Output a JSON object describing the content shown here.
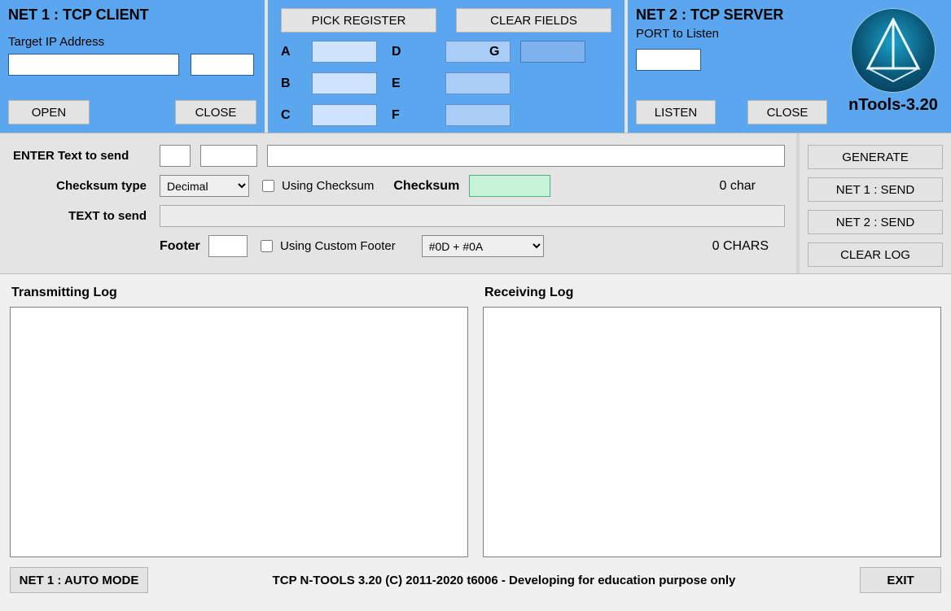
{
  "net1": {
    "title": "NET 1 : TCP CLIENT",
    "ip_label": "Target IP Address",
    "ip_value": "",
    "port_value": "",
    "open": "OPEN",
    "close": "CLOSE"
  },
  "regs": {
    "pick": "PICK REGISTER",
    "clear": "CLEAR FIELDS",
    "labels": {
      "A": "A",
      "B": "B",
      "C": "C",
      "D": "D",
      "E": "E",
      "F": "F",
      "G": "G"
    },
    "values": {
      "A": "",
      "B": "",
      "C": "",
      "D": "",
      "E": "",
      "F": "",
      "G": ""
    }
  },
  "net2": {
    "title": "NET 2 : TCP SERVER",
    "port_label": "PORT to Listen",
    "port_value": "",
    "listen": "LISTEN",
    "close": "CLOSE"
  },
  "branding": {
    "name": "nTools-3.20"
  },
  "form": {
    "enter_label": "ENTER Text to send",
    "small1": "",
    "small2": "",
    "long": "",
    "checksum_type_label": "Checksum type",
    "checksum_type_value": "Decimal",
    "using_checksum_label": "Using Checksum",
    "using_checksum_checked": false,
    "checksum_label": "Checksum",
    "checksum_value": "",
    "char_count": "0 char",
    "text_to_send_label": "TEXT to send",
    "text_to_send_value": "",
    "footer_label": "Footer",
    "footer_value": "",
    "using_custom_footer_label": "Using Custom Footer",
    "using_custom_footer_checked": false,
    "footer_select": "#0D + #0A",
    "chars_count": "0 CHARS"
  },
  "actions": {
    "generate": "GENERATE",
    "net1_send": "NET 1 : SEND",
    "net2_send": "NET 2 : SEND",
    "clear_log": "CLEAR LOG"
  },
  "logs": {
    "tx_label": "Transmitting Log",
    "rx_label": "Receiving Log"
  },
  "footer": {
    "auto": "NET 1 : AUTO MODE",
    "copy": "TCP N-TOOLS 3.20 (C) 2011-2020 t6006 - Developing for education purpose only",
    "exit": "EXIT"
  }
}
